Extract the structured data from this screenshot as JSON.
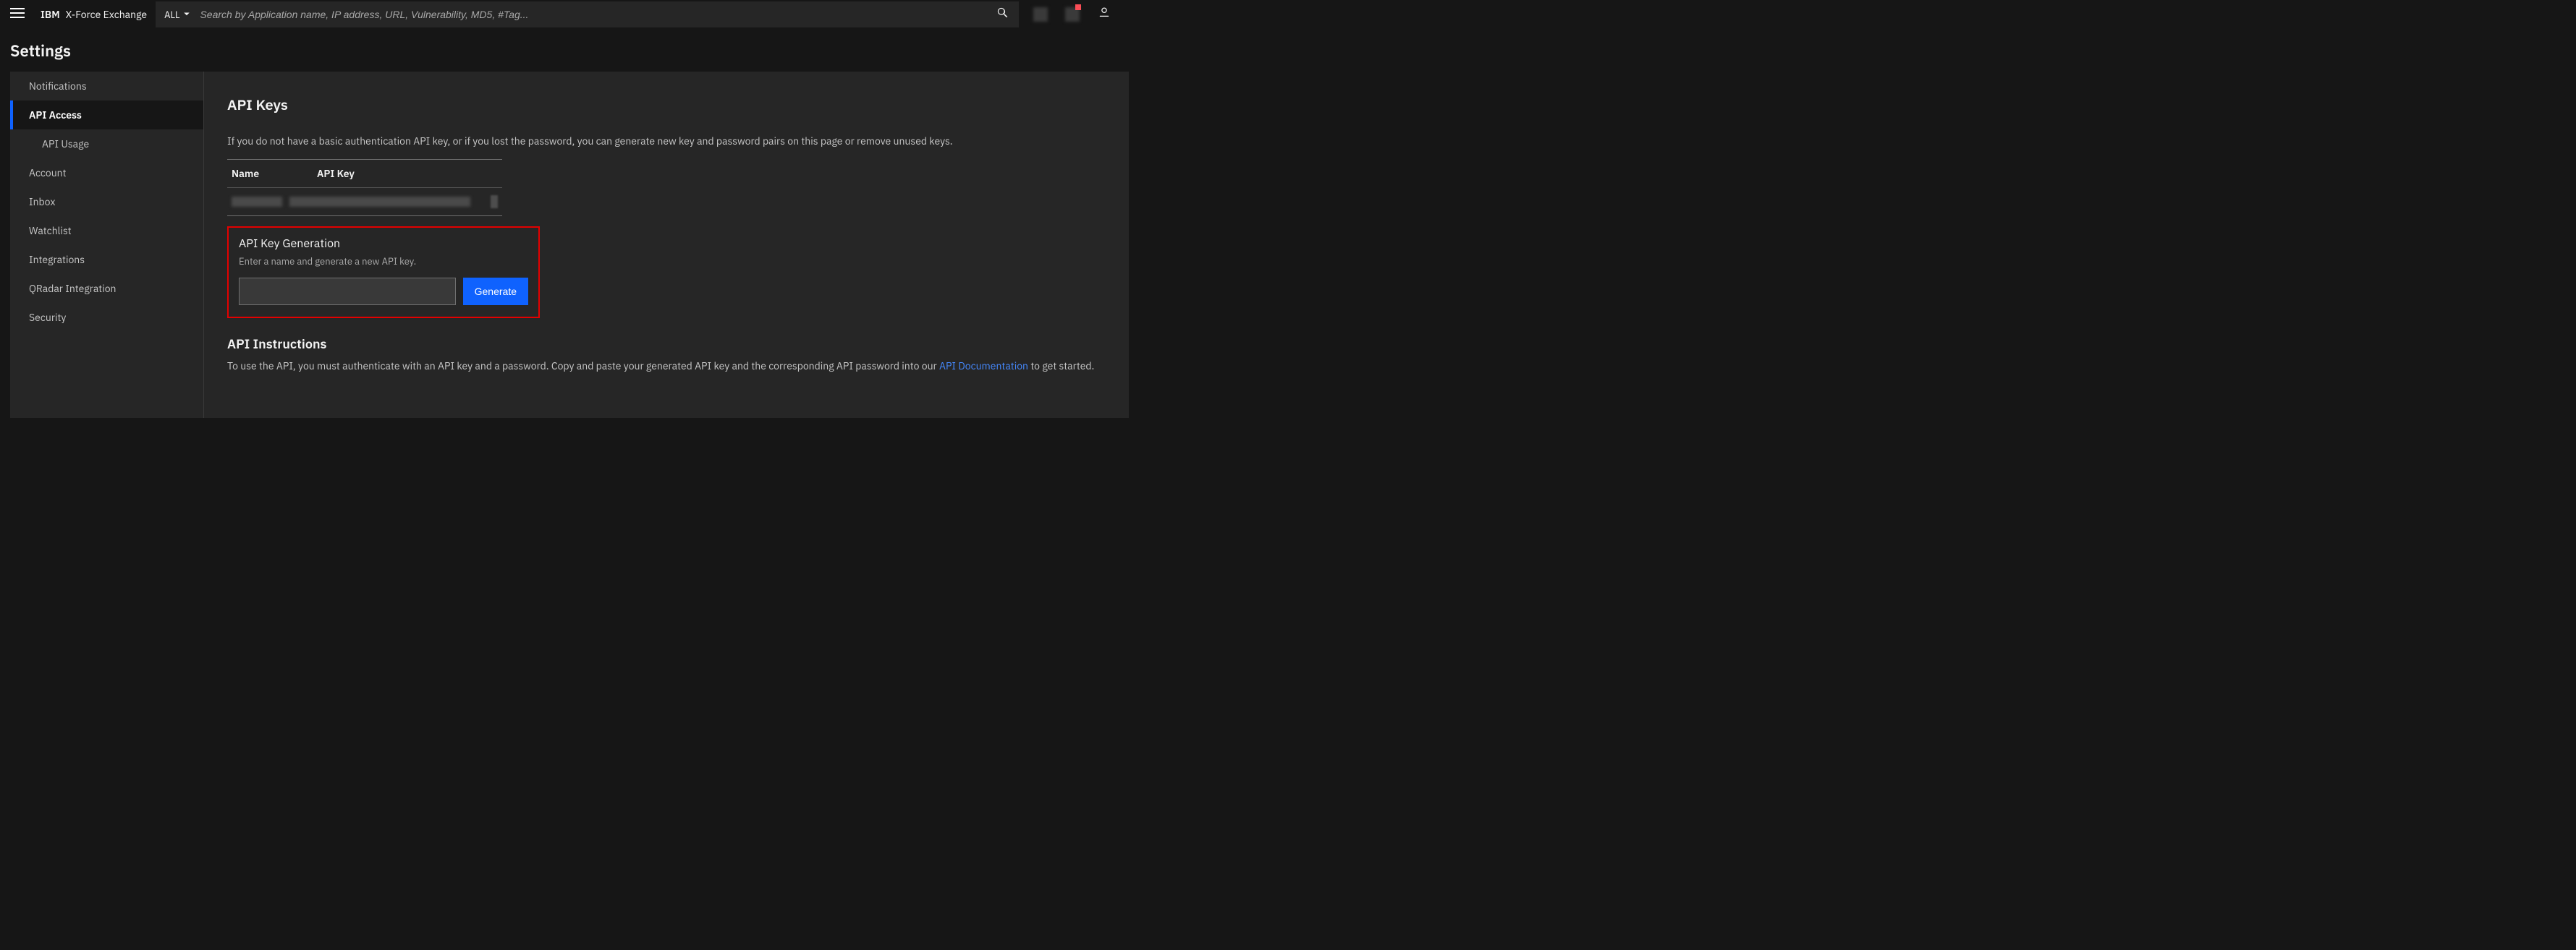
{
  "header": {
    "brand_bold": "IBM",
    "brand_light": "X-Force Exchange",
    "search_filter": "ALL",
    "search_placeholder": "Search by Application name, IP address, URL, Vulnerability, MD5, #Tag..."
  },
  "page_title": "Settings",
  "sidebar": {
    "items": [
      {
        "label": "Notifications",
        "active": false
      },
      {
        "label": "API Access",
        "active": true,
        "sub": [
          {
            "label": "API Usage"
          }
        ]
      },
      {
        "label": "Account",
        "active": false
      },
      {
        "label": "Inbox",
        "active": false
      },
      {
        "label": "Watchlist",
        "active": false
      },
      {
        "label": "Integrations",
        "active": false
      },
      {
        "label": "QRadar Integration",
        "active": false
      },
      {
        "label": "Security",
        "active": false
      }
    ]
  },
  "main": {
    "title": "API Keys",
    "description": "If you do not have a basic authentication API key, or if you lost the password, you can generate new key and password pairs on this page or remove unused keys.",
    "table": {
      "col_name": "Name",
      "col_key": "API Key"
    },
    "generation": {
      "title": "API Key Generation",
      "hint": "Enter a name and generate a new API key.",
      "button": "Generate"
    },
    "instructions": {
      "title": "API Instructions",
      "text_before": "To use the API, you must authenticate with an API key and a password. Copy and paste your generated API key and the corresponding API password into our ",
      "link_text": "API Documentation",
      "text_after": " to get started."
    }
  }
}
